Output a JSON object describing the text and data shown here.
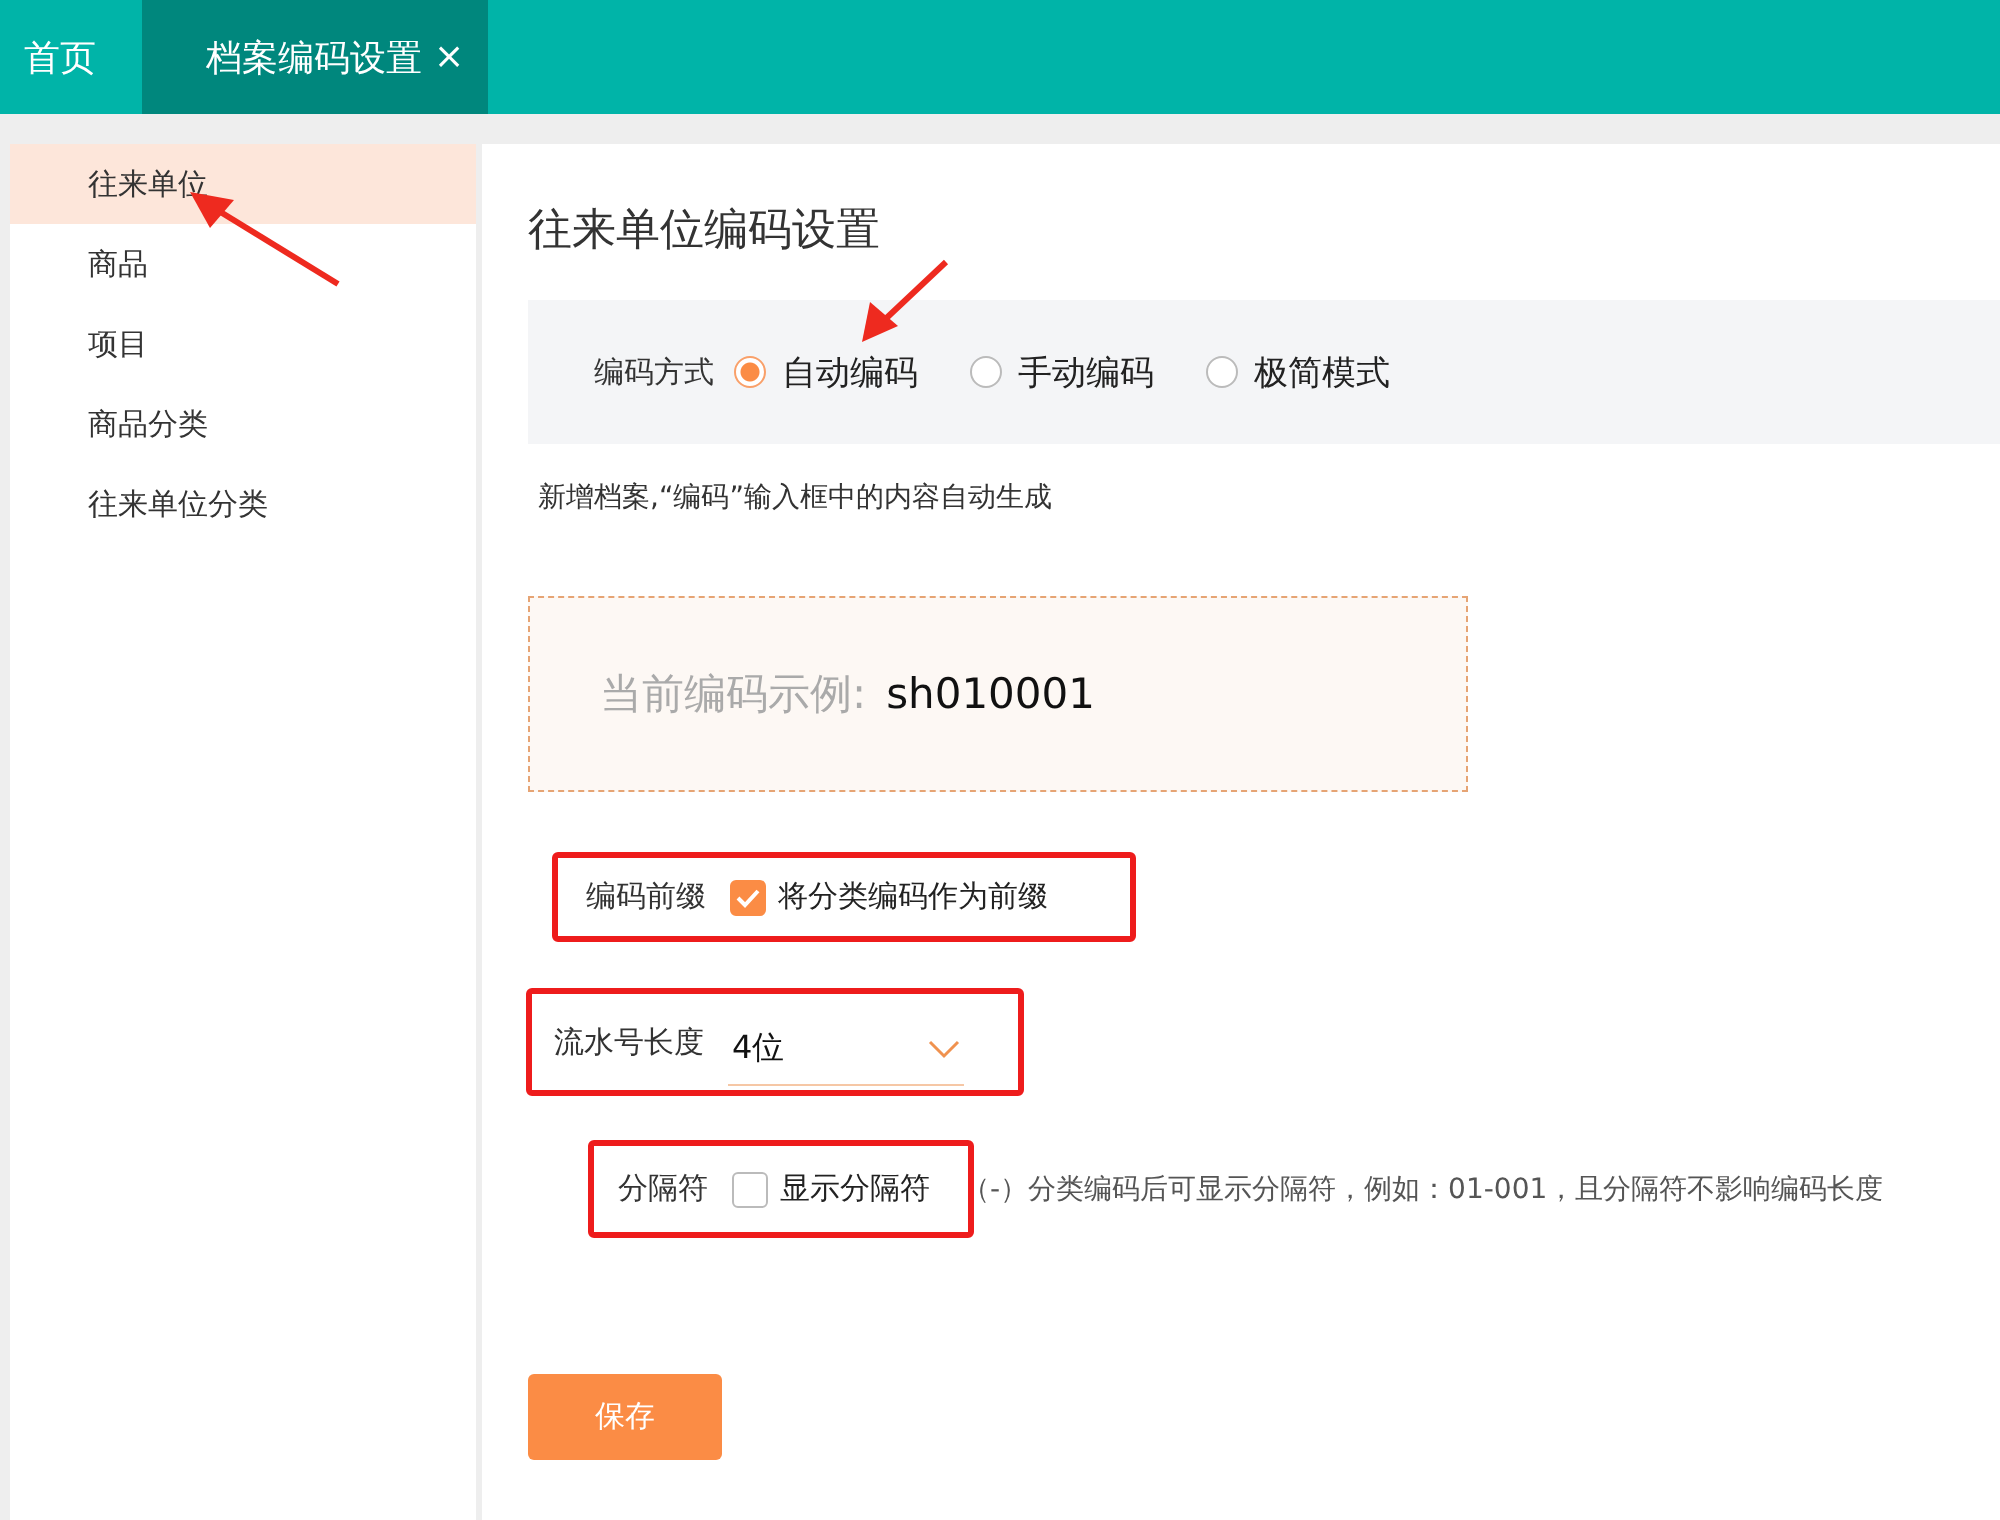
{
  "tabs": [
    {
      "label": "首页",
      "selected": false
    },
    {
      "label": "档案编码设置",
      "selected": true,
      "close_glyph": "×"
    }
  ],
  "sidebar": {
    "items": [
      {
        "label": "往来单位",
        "selected": true,
        "annotated": true
      },
      {
        "label": "商品",
        "selected": false,
        "annotated": false
      },
      {
        "label": "项目",
        "selected": false,
        "annotated": false
      },
      {
        "label": "商品分类",
        "selected": false,
        "annotated": false
      },
      {
        "label": "往来单位分类",
        "selected": false,
        "annotated": false
      }
    ]
  },
  "title": "往来单位编码设置",
  "coding_mode": {
    "label": "编码方式",
    "options": [
      {
        "label": "自动编码",
        "selected": true,
        "annotated": true
      },
      {
        "label": "手动编码",
        "selected": false,
        "annotated": false
      },
      {
        "label": "极简模式",
        "selected": false,
        "annotated": false
      }
    ]
  },
  "mode_hint": "新增档案,“编码”输入框中的内容自动生成",
  "example": {
    "label": "当前编码示例:",
    "value": "sh010001"
  },
  "prefix": {
    "label": "编码前缀",
    "option": "将分类编码作为前缀",
    "checked": true,
    "highlighted": true
  },
  "serial_length": {
    "label": "流水号长度",
    "value": "4位",
    "highlighted": true
  },
  "separator": {
    "label": "分隔符",
    "option": "显示分隔符",
    "checked": false,
    "highlighted": true,
    "hint": "（-）分类编码后可显示分隔符，例如：01-001，且分隔符不影响编码长度"
  },
  "save_button": "保存"
}
